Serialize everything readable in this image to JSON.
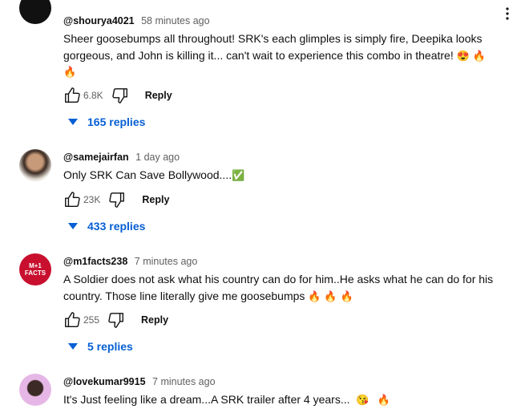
{
  "comments": [
    {
      "author": "@shourya4021",
      "time": "58 minutes ago",
      "text_main": "Sheer goosebumps all throughout! SRK's each glimples is simply fire, Deepika looks gorgeous, and John is killing it... can't wait to experience this combo in theatre!",
      "text_emojis": [
        "😍",
        "🔥",
        "🔥"
      ],
      "likes": "6.8K",
      "reply_label": "Reply",
      "replies_label": "165 replies",
      "avatar_icon": "dark-avatar"
    },
    {
      "author": "@samejairfan",
      "time": "1 day ago",
      "text_main": "Only SRK Can Save Bollywood....",
      "text_emojis": [
        "✅"
      ],
      "likes": "23K",
      "reply_label": "Reply",
      "replies_label": "433 replies",
      "avatar_icon": "photo-avatar"
    },
    {
      "author": "@m1facts238",
      "time": "7 minutes ago",
      "text_main": "A Soldier does not ask what his country can do for him..He asks what he can do for his country. Those line literally give me goosebumps",
      "text_emojis": [
        "🔥",
        "🔥",
        "🔥"
      ],
      "likes": "255",
      "reply_label": "Reply",
      "replies_label": "5 replies",
      "avatar_text": "M+1 FACTS",
      "avatar_icon": "logo-avatar"
    },
    {
      "author": "@lovekumar9915",
      "time": "7 minutes ago",
      "text_main": "It's Just feeling like a dream...A SRK trailer after 4 years...",
      "text_emojis": [
        "😘",
        "🔥"
      ],
      "avatar_icon": "photo-avatar"
    }
  ],
  "colors": {
    "link_blue": "#065fd4",
    "secondary_text": "#606060"
  }
}
